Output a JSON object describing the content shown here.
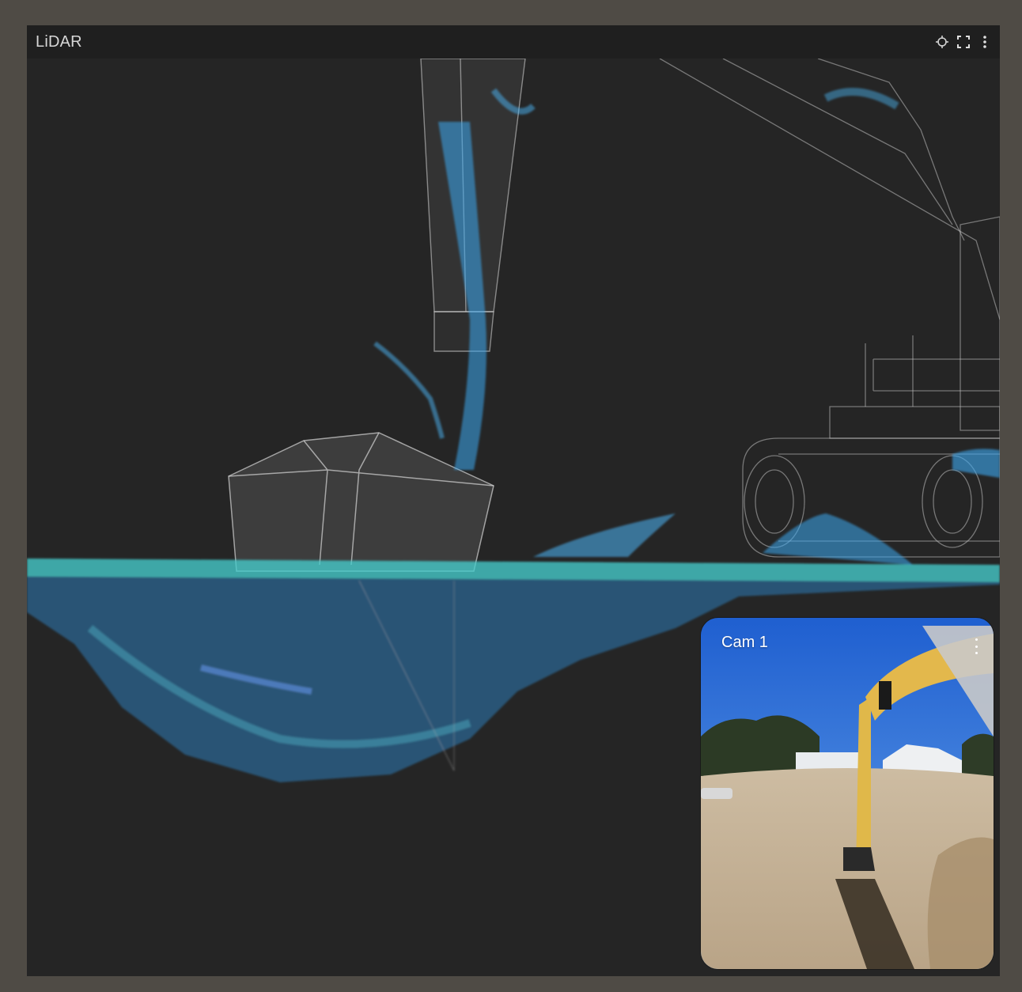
{
  "panel": {
    "title": "LiDAR",
    "tools": [
      {
        "name": "recenter-icon",
        "glyph": "crosshair"
      },
      {
        "name": "fullscreen-icon",
        "glyph": "brackets"
      },
      {
        "name": "more-menu-icon",
        "glyph": "vertical-dots"
      }
    ]
  },
  "camera": {
    "title": "Cam 1",
    "menu_icon": "vertical-dots"
  },
  "colors": {
    "background": "#4f4b45",
    "panel": "#252525",
    "header": "#1f1f1f",
    "point_cloud_primary": "#3aa8f0",
    "point_cloud_secondary": "#4fe0c8",
    "wireframe": "#cfcfcf"
  }
}
